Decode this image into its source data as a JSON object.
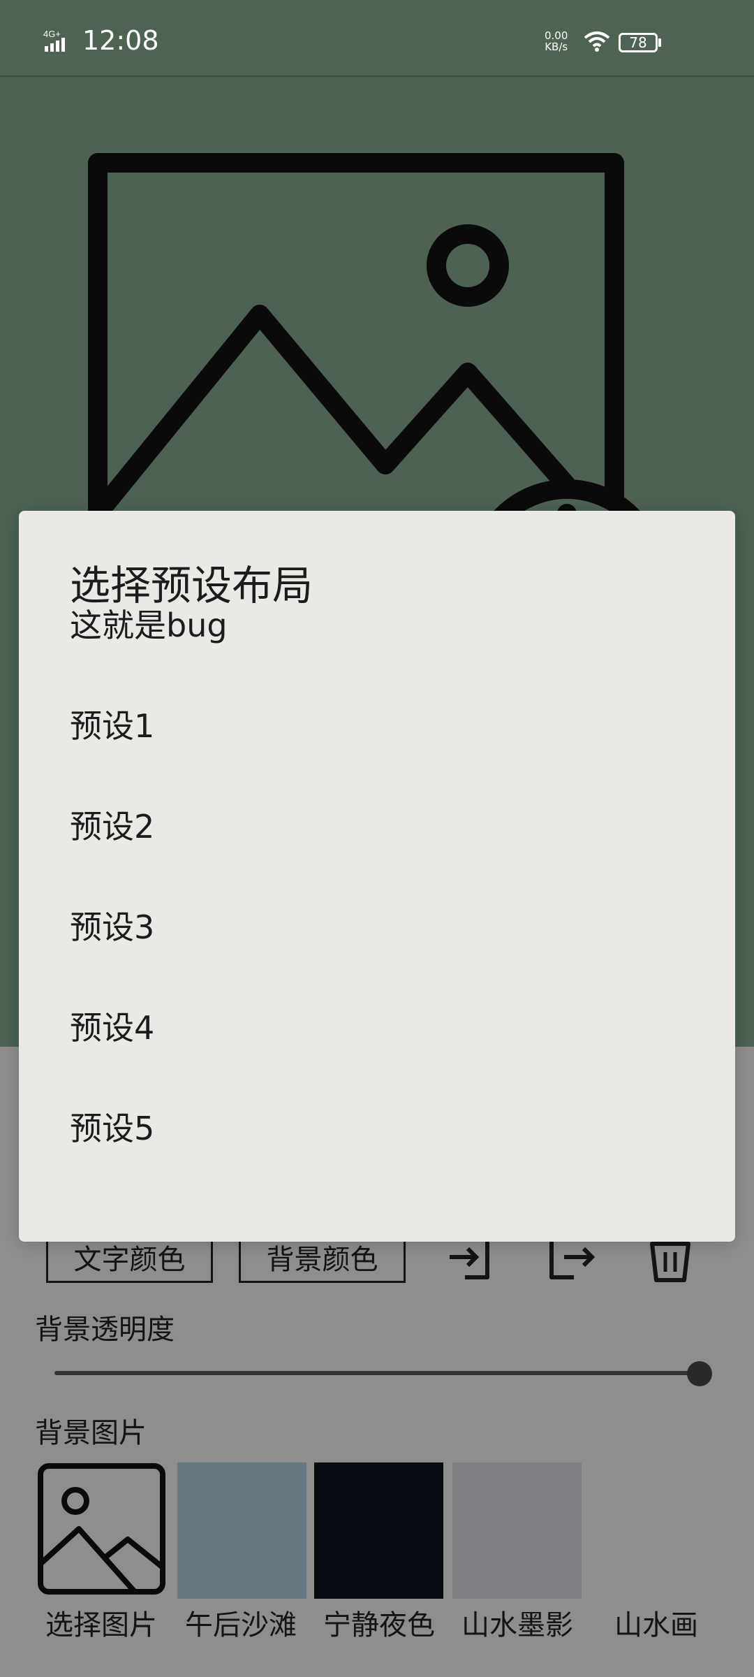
{
  "status_bar": {
    "network": "4G+",
    "time": "12:08",
    "speed_value": "0.00",
    "speed_unit": "KB/s",
    "battery": "78",
    "wifi_icon": "wifi-icon"
  },
  "preview": {
    "icon": "image-placeholder-icon",
    "background_color": "#7fa088"
  },
  "dialog": {
    "title": "选择预设布局",
    "options": [
      "这就是bug",
      "预设1",
      "预设2",
      "预设3",
      "预设4",
      "预设5"
    ]
  },
  "settings": {
    "text_color_button": "文字颜色",
    "bg_color_button": "背景颜色",
    "import_icon": "import-icon",
    "export_icon": "export-icon",
    "delete_icon": "trash-icon",
    "bg_opacity_label": "背景透明度",
    "bg_opacity_value_percent": 100,
    "bg_image_label": "背景图片",
    "thumbnails": [
      {
        "caption": "选择图片",
        "color": "#e9e8e5",
        "icon": "image-placeholder-icon"
      },
      {
        "caption": "午后沙滩",
        "color": "#a9c4d1"
      },
      {
        "caption": "宁静夜色",
        "color": "#0d141e"
      },
      {
        "caption": "山水墨影",
        "color": "#cfd0d5"
      },
      {
        "caption": "山水画",
        "color": "#e8e8e8"
      }
    ]
  }
}
